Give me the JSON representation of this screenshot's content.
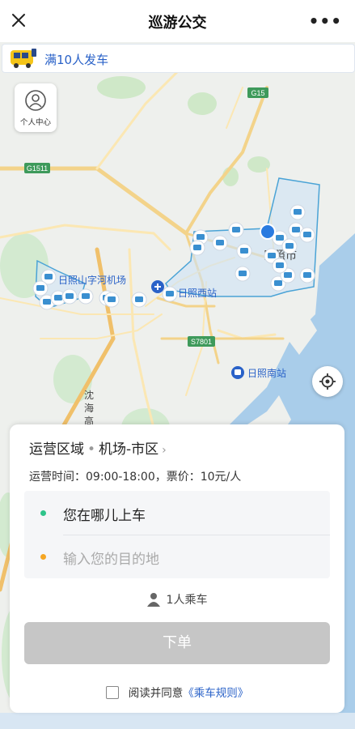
{
  "header": {
    "title": "巡游公交",
    "more": "•••"
  },
  "banner": {
    "text": "满10人发车"
  },
  "personal_center": {
    "label": "个人中心"
  },
  "map": {
    "roads": [
      "G15",
      "G1511",
      "S7801"
    ],
    "places": [
      "日照山字河机场",
      "日照西站",
      "日照南站",
      "日照市"
    ],
    "river_label": [
      "沈",
      "海",
      "高"
    ]
  },
  "panel": {
    "region_label": "运营区域",
    "region_value": "机场-市区",
    "hours_text": "运营时间：09:00-18:00，票价：10元/人",
    "pickup_placeholder": "您在哪儿上车",
    "destination_placeholder": "输入您的目的地",
    "passengers": "1人乘车",
    "order_button": "下单",
    "agree_text": "阅读并同意",
    "rules_link": "《乘车规则》"
  },
  "colors": {
    "accent": "#2a62c8",
    "pickup_dot": "#2ec48a",
    "dest_dot": "#f5a623",
    "water": "#a9cdea",
    "zone": "#cfe3f5"
  }
}
